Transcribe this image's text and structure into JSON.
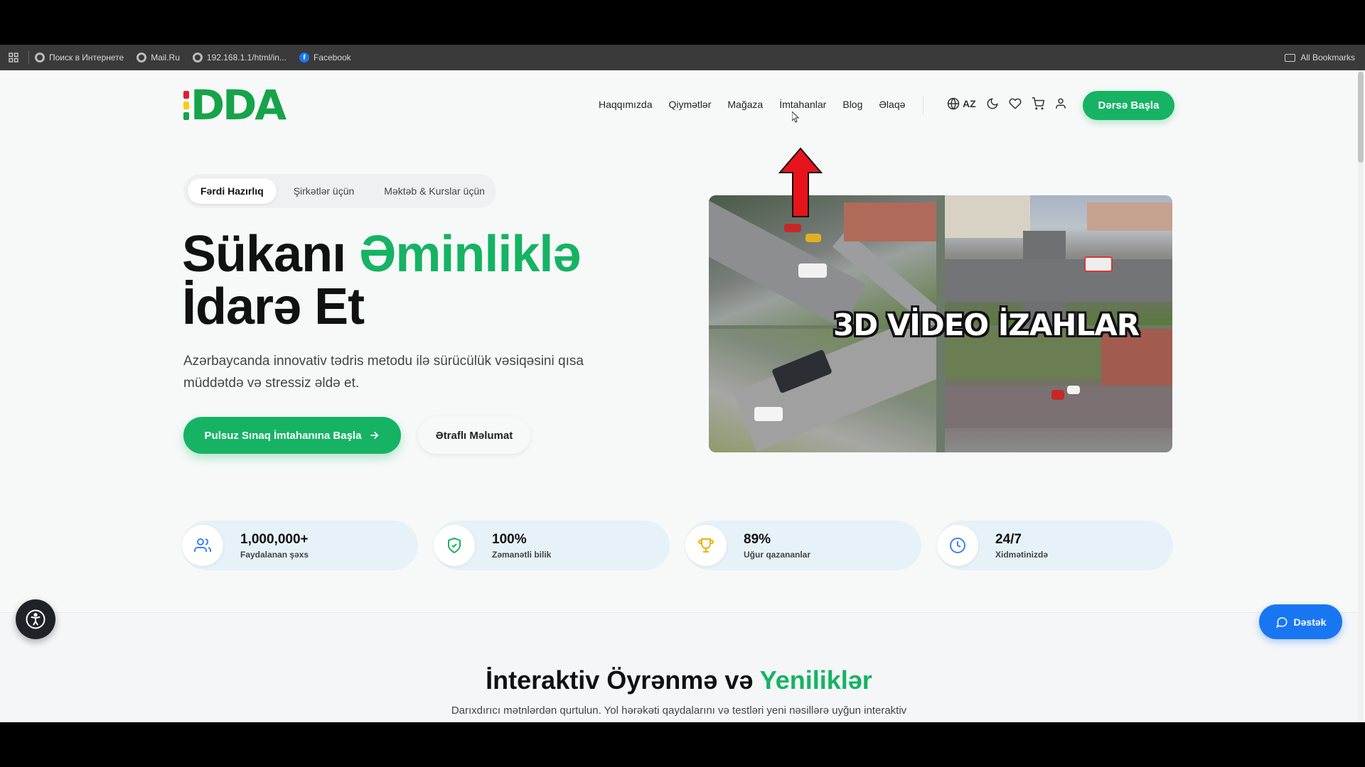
{
  "bookmarks": {
    "items": [
      {
        "label": "Поиск в Интернете",
        "icon": "globe-icon"
      },
      {
        "label": "Mail.Ru",
        "icon": "globe-icon"
      },
      {
        "label": "192.168.1.1/html/in...",
        "icon": "globe-icon"
      },
      {
        "label": "Facebook",
        "icon": "facebook-icon"
      }
    ],
    "all_label": "All Bookmarks"
  },
  "header": {
    "logo_text": "DDA",
    "nav": [
      "Haqqımızda",
      "Qiymətlər",
      "Mağaza",
      "İmtahanlar",
      "Blog",
      "Əlaqə"
    ],
    "language": "AZ",
    "cta_label": "Dərsə Başla"
  },
  "hero": {
    "tabs": [
      "Fərdi Hazırlıq",
      "Şirkətlər üçün",
      "Məktəb & Kurslar üçün"
    ],
    "active_tab": "Fərdi Hazırlıq",
    "title_part1": "Sükanı ",
    "title_highlight": "Əminliklə",
    "title_line2": "İdarə Et",
    "subtitle": "Azərbaycanda innovativ tədris metodu ilə sürücülük vəsiqəsini qısa müddətdə və stressiz əldə et.",
    "primary_button": "Pulsuz Sınaq İmtahanına Başla",
    "secondary_button": "Ətraflı Məlumat",
    "video_title": "3D VİDEO İZAHLAR"
  },
  "stats": [
    {
      "value": "1,000,000+",
      "label": "Faydalanan şəxs",
      "icon": "users-icon",
      "color": "#3b82f6"
    },
    {
      "value": "100%",
      "label": "Zəmanətli bilik",
      "icon": "shield-check-icon",
      "color": "#16b364"
    },
    {
      "value": "89%",
      "label": "Uğur qazananlar",
      "icon": "trophy-icon",
      "color": "#eab308"
    },
    {
      "value": "24/7",
      "label": "Xidmətinizdə",
      "icon": "clock-icon",
      "color": "#3b82f6"
    }
  ],
  "section": {
    "title_part1": "İnteraktiv Öyrənmə və ",
    "title_highlight": "Yeniliklər",
    "subtitle": "Darıxdırıcı mətnlərdən qurtulun. Yol hərəkəti qaydalarını və testləri yeni nəsillərə uyğun interaktiv"
  },
  "widgets": {
    "support_label": "Dəstək"
  },
  "colors": {
    "brand_green": "#16b364",
    "support_blue": "#1976f2",
    "annotation_red": "#e8141b"
  }
}
